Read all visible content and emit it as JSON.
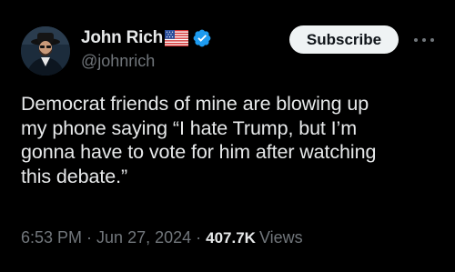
{
  "author": {
    "display_name": "John Rich",
    "handle": "@johnrich",
    "flag_icon": "us-flag-icon",
    "verified_icon": "verified-badge-icon",
    "verified_color": "#1d9bf0"
  },
  "actions": {
    "subscribe_label": "Subscribe",
    "more_icon": "more-dots-icon"
  },
  "tweet": {
    "text": "Democrat friends of mine are blowing up\nmy phone saying “I hate Trump, but I’m\ngonna have to vote for him after watching\nthis debate.”"
  },
  "meta": {
    "time": "6:53 PM",
    "date": "Jun 27, 2024",
    "separator": "·",
    "views_count": "407.7K",
    "views_label": "Views"
  },
  "colors": {
    "background": "#000000",
    "primary_text": "#e7e9ea",
    "secondary_text": "#71767b",
    "button_bg": "#eff3f4",
    "button_text": "#0f1419"
  }
}
